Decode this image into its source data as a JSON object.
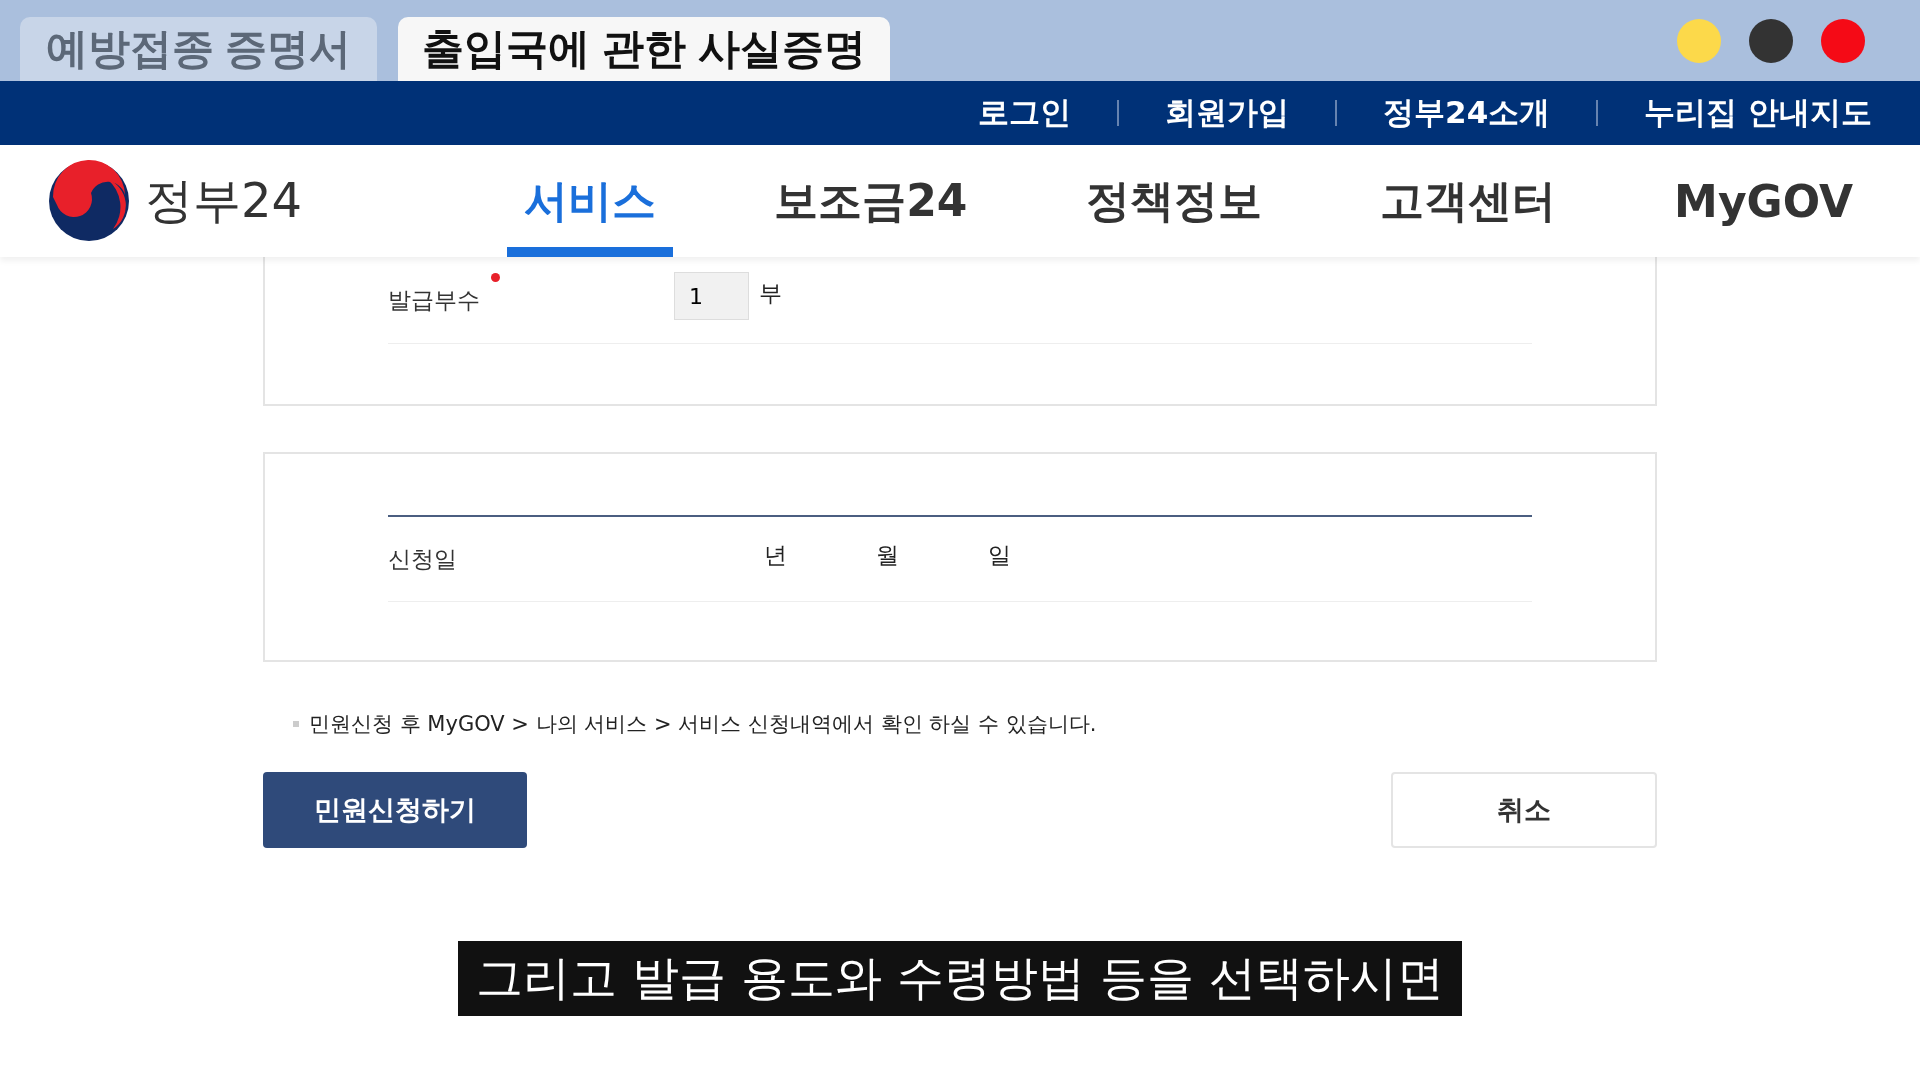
{
  "browser_tabs": [
    {
      "label": "예방접종 증명서",
      "selected": false
    },
    {
      "label": "출입국에 관한 사실증명",
      "selected": true
    }
  ],
  "window_dots": [
    {
      "color": "#fcd94a"
    },
    {
      "color": "#333333"
    },
    {
      "color": "#f50a16"
    }
  ],
  "util_links": [
    "로그인",
    "회원가입",
    "정부24소개",
    "누리집 안내지도"
  ],
  "logo": {
    "text": "정부24"
  },
  "nav_tabs": [
    {
      "label": "서비스",
      "selected": true
    },
    {
      "label": "보조금24",
      "selected": false
    },
    {
      "label": "정책정보",
      "selected": false
    },
    {
      "label": "고객센터",
      "selected": false
    },
    {
      "label": "MyGOV",
      "selected": false
    }
  ],
  "copies_row": {
    "label": "발급부수",
    "required": true,
    "value": "1",
    "unit": "부"
  },
  "date_row": {
    "label": "신청일",
    "units": [
      "년",
      "월",
      "일"
    ]
  },
  "note": "민원신청 후 MyGOV > 나의 서비스 > 서비스 신청내역에서 확인 하실 수 있습니다.",
  "buttons": [
    {
      "label": "민원신청하기",
      "kind": "primary"
    },
    {
      "label": "취소",
      "kind": "secondary"
    }
  ],
  "subtitle": "그리고 발급 용도와 수령방법 등을 선택하시면"
}
